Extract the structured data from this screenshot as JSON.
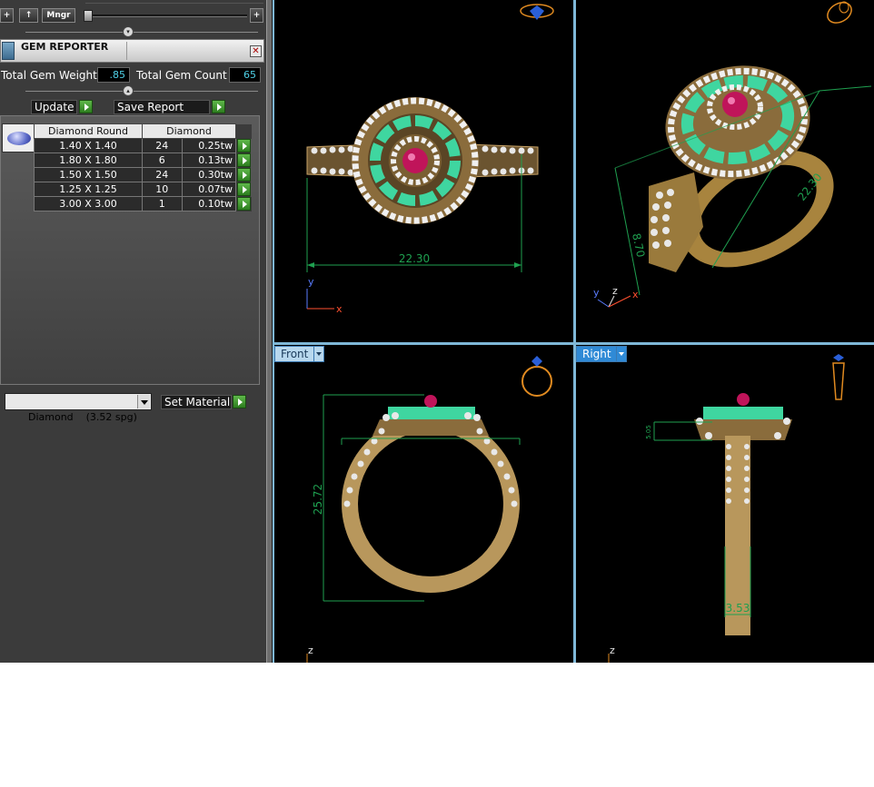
{
  "toolbar": {
    "add_label": "+",
    "up_label": "↑",
    "mngr_label": "Mngr",
    "plus_label": "+"
  },
  "gem_reporter": {
    "title": "GEM REPORTER",
    "close_label": "✕",
    "total_weight_label": "Total Gem Weight",
    "total_weight_value": ".85",
    "total_count_label": "Total Gem Count",
    "total_count_value": "65",
    "update_label": "Update",
    "save_report_label": "Save Report",
    "table": {
      "headers": [
        "Diamond Round",
        "Diamond"
      ],
      "rows": [
        {
          "size": "1.40 X 1.40",
          "count": "24",
          "weight": "0.25tw"
        },
        {
          "size": "1.80 X 1.80",
          "count": "6",
          "weight": "0.13tw"
        },
        {
          "size": "1.50 X 1.50",
          "count": "24",
          "weight": "0.30tw"
        },
        {
          "size": "1.25 X 1.25",
          "count": "10",
          "weight": "0.07tw"
        },
        {
          "size": "3.00 X 3.00",
          "count": "1",
          "weight": "0.10tw"
        }
      ]
    },
    "material_value": "Diamond    (3.52 spg)",
    "set_material_label": "Set Material"
  },
  "viewports": {
    "top": {
      "dimension": "22.30",
      "axis_y": "y",
      "axis_x": "x"
    },
    "perspective": {
      "dimension_a": "22.30",
      "dimension_b": "8.70",
      "axis_y": "y",
      "axis_z": "z",
      "axis_x": "x"
    },
    "front": {
      "tab_label": "Front",
      "dimension": "25.72",
      "axis_z": "z"
    },
    "right": {
      "tab_label": "Right",
      "dimension": "3.53",
      "dimension_small": "5.05",
      "axis_z": "z"
    }
  },
  "colors": {
    "viewport_bg": "#000000",
    "panel_bg": "#3b3b3b",
    "tab_blue": "#7fb8d8",
    "dimension_green": "#1fa050",
    "gold": "#c9a467",
    "emerald": "#3fd6a0",
    "ruby": "#c0145a"
  }
}
